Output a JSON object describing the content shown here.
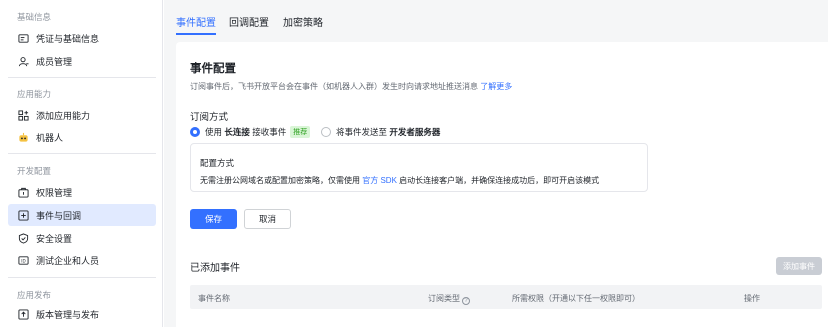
{
  "sidebar": {
    "sections": [
      {
        "title": "基础信息"
      },
      {
        "title": "应用能力"
      },
      {
        "title": "开发配置"
      },
      {
        "title": "应用发布"
      }
    ],
    "items": [
      {
        "label": "凭证与基础信息"
      },
      {
        "label": "成员管理"
      },
      {
        "label": "添加应用能力"
      },
      {
        "label": "机器人"
      },
      {
        "label": "权限管理"
      },
      {
        "label": "事件与回调"
      },
      {
        "label": "安全设置"
      },
      {
        "label": "测试企业和人员"
      },
      {
        "label": "版本管理与发布"
      }
    ]
  },
  "tabs": [
    {
      "label": "事件配置"
    },
    {
      "label": "回调配置"
    },
    {
      "label": "加密策略"
    }
  ],
  "event_config": {
    "title": "事件配置",
    "description": "订阅事件后，飞书开放平台会在事件（如机器人入群）发生时向请求地址推送消息",
    "learn_more": "了解更多",
    "subscribe_mode_title": "订阅方式",
    "option_long_conn_prefix": "使用",
    "option_long_conn_bold": "长连接",
    "option_long_conn_suffix": "接收事件",
    "recommend_tag": "推荐",
    "option_server_prefix": "将事件发送至",
    "option_server_bold": "开发者服务器",
    "config_box_title": "配置方式",
    "config_box_desc_a": "无需注册公网域名或配置加密策略，仅需使用",
    "config_box_sdk": "官方 SDK",
    "config_box_desc_b": "启动长连接客户端，并确保连接成功后，即可开启该模式",
    "save_label": "保存",
    "cancel_label": "取消"
  },
  "added_events": {
    "title": "已添加事件",
    "add_button": "添加事件",
    "columns": [
      "事件名称",
      "订阅类型",
      "所需权限（开通以下任一权限即可）",
      "操作"
    ]
  },
  "colors": {
    "accent": "#3370ff",
    "active_nav_bg": "#e1eaff",
    "recommend_tag": "#2ea121"
  }
}
